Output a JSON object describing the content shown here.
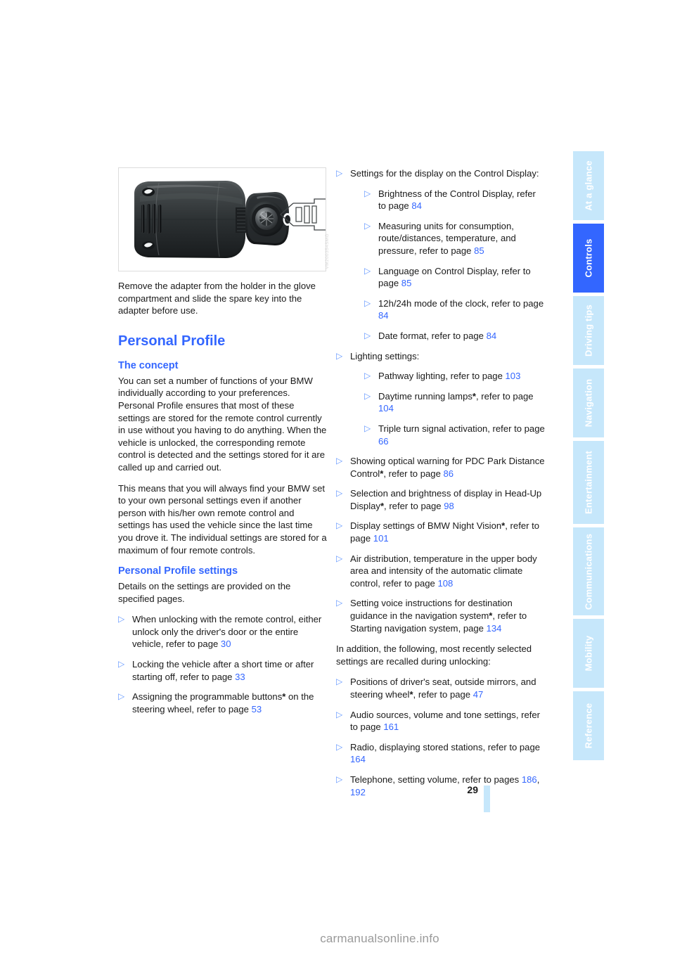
{
  "document": {
    "page_number": "29",
    "watermark": "carmanualsonline.info"
  },
  "figure": {
    "alt_name": "remote-control-key-with-adapter",
    "code": "VM200354SMG"
  },
  "sidebar": {
    "tabs": [
      {
        "label": "At a glance",
        "active": false
      },
      {
        "label": "Controls",
        "active": true
      },
      {
        "label": "Driving tips",
        "active": false
      },
      {
        "label": "Navigation",
        "active": false
      },
      {
        "label": "Entertainment",
        "active": false
      },
      {
        "label": "Communications",
        "active": false
      },
      {
        "label": "Mobility",
        "active": false
      },
      {
        "label": "Reference",
        "active": false
      }
    ],
    "active_color": "#3366ff",
    "inactive_color": "#c6e7fb"
  },
  "left_column": {
    "figure_caption": "Remove the adapter from the holder in the glove compartment and slide the spare key into the adapter before use.",
    "title": "Personal Profile",
    "section_concept": {
      "heading": "The concept",
      "paragraph_1": "You can set a number of functions of your BMW individually according to your preferences. Personal Profile ensures that most of these settings are stored for the remote control currently in use without you having to do anything. When the vehicle is unlocked, the corresponding remote control is detected and the settings stored for it are called up and carried out.",
      "paragraph_2": "This means that you will always find your BMW set to your own personal settings even if another person with his/her own remote control and settings has used the vehicle since the last time you drove it. The individual settings are stored for a maximum of four remote controls."
    },
    "section_settings": {
      "heading": "Personal Profile settings",
      "intro": "Details on the settings are provided on the specified pages.",
      "items": [
        {
          "text_before": "When unlocking with the remote control, either unlock only the driver's door or the entire vehicle, refer to page ",
          "page_ref": "30",
          "text_after": ""
        },
        {
          "text_before": "Locking the vehicle after a short time or after starting off, refer to page ",
          "page_ref": "33",
          "text_after": ""
        },
        {
          "text_before": "Assigning the programmable buttons",
          "star": "*",
          "text_mid": " on the steering wheel, refer to page ",
          "page_ref": "53",
          "text_after": ""
        }
      ]
    }
  },
  "right_column": {
    "item_display": {
      "text": "Settings for the display on the Control Display:",
      "subitems": [
        {
          "text_before": "Brightness of the Control Display, refer to page ",
          "page_ref": "84",
          "text_after": ""
        },
        {
          "text_before": "Measuring units for consumption, route/distances, temperature, and pressure, refer to page ",
          "page_ref": "85",
          "text_after": ""
        },
        {
          "text_before": "Language on Control Display, refer to page ",
          "page_ref": "85",
          "text_after": ""
        },
        {
          "text_before": "12h/24h mode of the clock, refer to page ",
          "page_ref": "84",
          "text_after": ""
        },
        {
          "text_before": "Date format, refer to page ",
          "page_ref": "84",
          "text_after": ""
        }
      ]
    },
    "item_lighting": {
      "text": "Lighting settings:",
      "subitems": [
        {
          "text_before": "Pathway lighting, refer to page ",
          "page_ref": "103",
          "text_after": ""
        },
        {
          "text_before": "Daytime running lamps",
          "star": "*",
          "text_mid": ", refer to page ",
          "page_ref": "104",
          "text_after": ""
        },
        {
          "text_before": "Triple turn signal activation, refer to page ",
          "page_ref": "66",
          "text_after": ""
        }
      ]
    },
    "items_after": [
      {
        "text_before": "Showing optical warning for PDC Park Distance Control",
        "star": "*",
        "text_mid": ", refer to page ",
        "page_ref": "86",
        "text_after": ""
      },
      {
        "text_before": "Selection and brightness of display in Head-Up Display",
        "star": "*",
        "text_mid": ", refer to page ",
        "page_ref": "98",
        "text_after": ""
      },
      {
        "text_before": "Display settings of BMW Night Vision",
        "star": "*",
        "text_mid": ", refer to page ",
        "page_ref": "101",
        "text_after": ""
      },
      {
        "text_before": "Air distribution, temperature in the upper body area and intensity of the automatic climate control, refer to page ",
        "page_ref": "108",
        "text_after": ""
      },
      {
        "text_before": "Setting voice instructions for destination guidance in the navigation system",
        "star": "*",
        "text_mid": ", refer to Starting navigation system, page ",
        "page_ref": "134",
        "text_after": ""
      }
    ],
    "recall_intro": "In addition, the following, most recently selected settings are recalled during unlocking:",
    "recall_items": [
      {
        "text_before": "Positions of driver's seat, outside mirrors, and steering wheel",
        "star": "*",
        "text_mid": ", refer to page ",
        "page_ref": "47",
        "text_after": ""
      },
      {
        "text_before": "Audio sources, volume and tone settings, refer to page ",
        "page_ref": "161",
        "text_after": ""
      },
      {
        "text_before": "Radio, displaying stored stations, refer to page ",
        "page_ref": "164",
        "text_after": ""
      },
      {
        "text_before": "Telephone, setting volume, refer to pages ",
        "page_ref": "186",
        "text_mid2": ", ",
        "page_ref2": "192",
        "text_after": ""
      }
    ]
  },
  "icons": {
    "bullet": "▷"
  }
}
